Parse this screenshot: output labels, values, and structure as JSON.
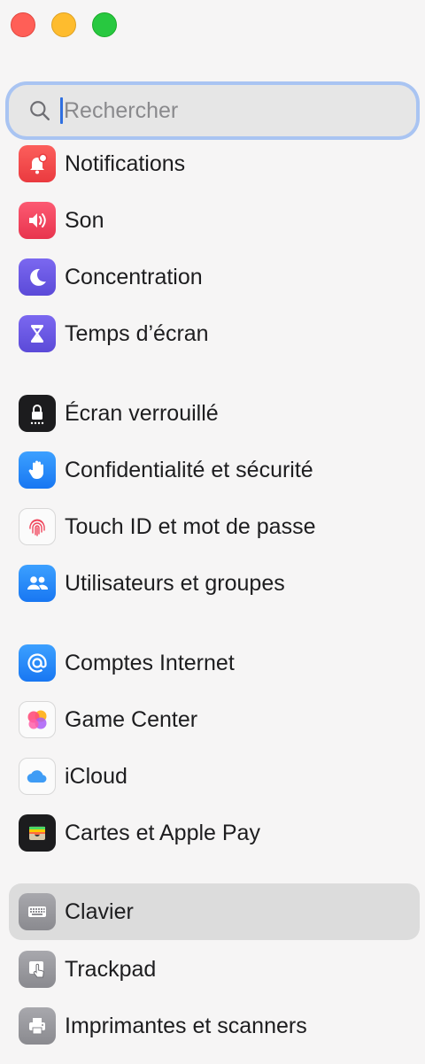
{
  "search": {
    "placeholder": "Rechercher"
  },
  "items": [
    {
      "label": "Notifications"
    },
    {
      "label": "Son"
    },
    {
      "label": "Concentration"
    },
    {
      "label": "Temps d’écran"
    },
    {
      "label": "Écran verrouillé"
    },
    {
      "label": "Confidentialité et sécurité"
    },
    {
      "label": "Touch ID et mot de passe"
    },
    {
      "label": "Utilisateurs et groupes"
    },
    {
      "label": "Comptes Internet"
    },
    {
      "label": "Game Center"
    },
    {
      "label": "iCloud"
    },
    {
      "label": "Cartes et Apple Pay"
    },
    {
      "label": "Clavier"
    },
    {
      "label": "Trackpad"
    },
    {
      "label": "Imprimantes et scanners"
    }
  ],
  "selected_item": "Clavier",
  "colors": {
    "accent": "#2f6fe0",
    "selection": "#dcdcdc"
  }
}
